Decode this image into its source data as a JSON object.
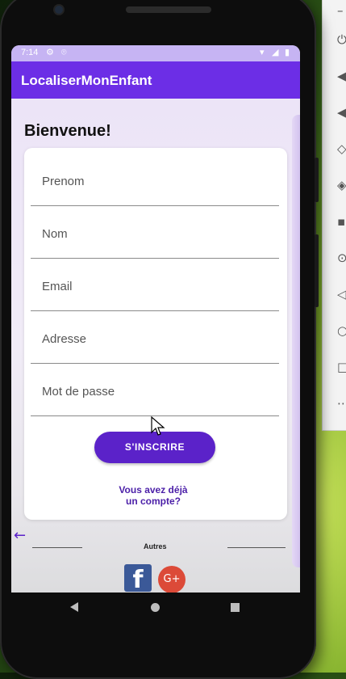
{
  "status_bar": {
    "time": "7:14"
  },
  "app_bar": {
    "title": "LocaliserMonEnfant"
  },
  "main": {
    "heading": "Bienvenue!",
    "form": {
      "fields": [
        {
          "placeholder": "Prenom"
        },
        {
          "placeholder": "Nom"
        },
        {
          "placeholder": "Email"
        },
        {
          "placeholder": "Adresse"
        },
        {
          "placeholder": "Mot de passe"
        }
      ],
      "submit_label": "S'INSCRIRE",
      "account_link_line1": "Vous avez déjà",
      "account_link_line2": "un compte?"
    },
    "divider_label": "Autres",
    "social": [
      {
        "name": "facebook",
        "glyph": "f"
      },
      {
        "name": "google-plus",
        "glyph": "G+"
      }
    ]
  },
  "colors": {
    "primary": "#6c2ee6",
    "button": "#5b22c9",
    "status_bar": "#c6b4f3",
    "facebook": "#3b5998",
    "google_plus": "#dc4a38"
  },
  "icons": {
    "status": [
      "settings-icon",
      "location-icon",
      "wifi-icon",
      "signal-icon",
      "battery-icon"
    ],
    "nav": [
      "nav-back-icon",
      "nav-home-icon",
      "nav-recents-icon"
    ],
    "screen": [
      "back-arrow-icon",
      "mouse-cursor-icon"
    ]
  }
}
